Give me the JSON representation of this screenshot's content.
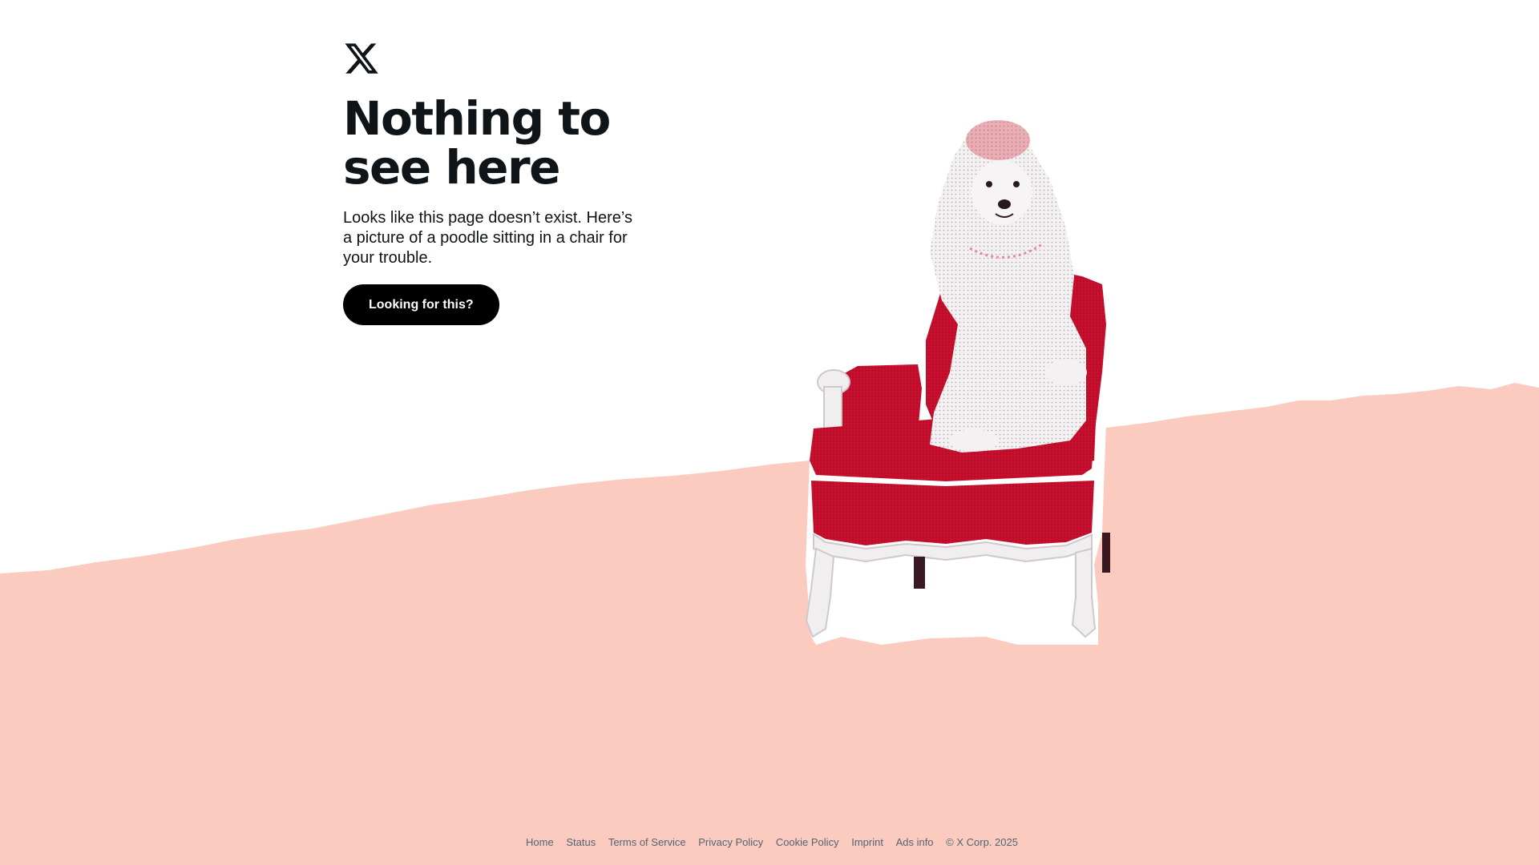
{
  "brand": {
    "logo_icon": "x-logo-icon",
    "text_color": "#0f1419",
    "accent_pink": "#fbcbc0",
    "chair_red": "#c8102e"
  },
  "error_page": {
    "headline_line1": "Nothing to",
    "headline_line2": "see here",
    "description": "Looks like this page doesn’t exist. Here’s a picture of a poodle sitting in a chair for your trouble.",
    "cta_label": "Looking for this?"
  },
  "footer": {
    "links": [
      {
        "label": "Home"
      },
      {
        "label": "Status"
      },
      {
        "label": "Terms of Service"
      },
      {
        "label": "Privacy Policy"
      },
      {
        "label": "Cookie Policy"
      },
      {
        "label": "Imprint"
      },
      {
        "label": "Ads info"
      }
    ],
    "copyright": "© X Corp. 2025"
  }
}
